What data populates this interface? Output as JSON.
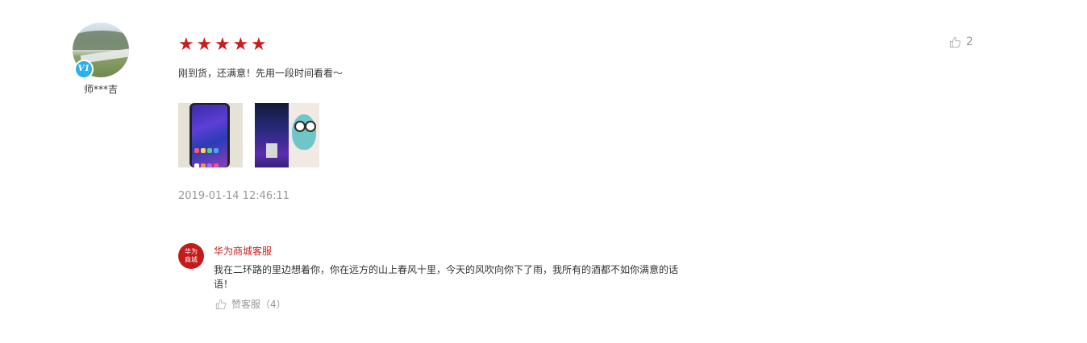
{
  "reviewer": {
    "name": "师***吉",
    "badge": "V1"
  },
  "review": {
    "rating": 5,
    "stars": [
      "★",
      "★",
      "★",
      "★",
      "★"
    ],
    "text": "刚到货，还满意！先用一段时间看看～",
    "timestamp": "2019-01-14 12:46:11",
    "likes": "2",
    "images": [
      "phone-front-photo",
      "phone-back-with-case-photo"
    ]
  },
  "customer_service": {
    "logo_text": "华为商城",
    "name": "华为商城客服",
    "reply": "我在二环路的里边想着你，你在远方的山上春风十里，今天的风吹向你下了雨，我所有的酒都不如你满意的话语！",
    "like_label": "赞客服（4）"
  },
  "colors": {
    "accent": "#c71e1e",
    "muted": "#999999",
    "badge": "#2ab0ec"
  }
}
